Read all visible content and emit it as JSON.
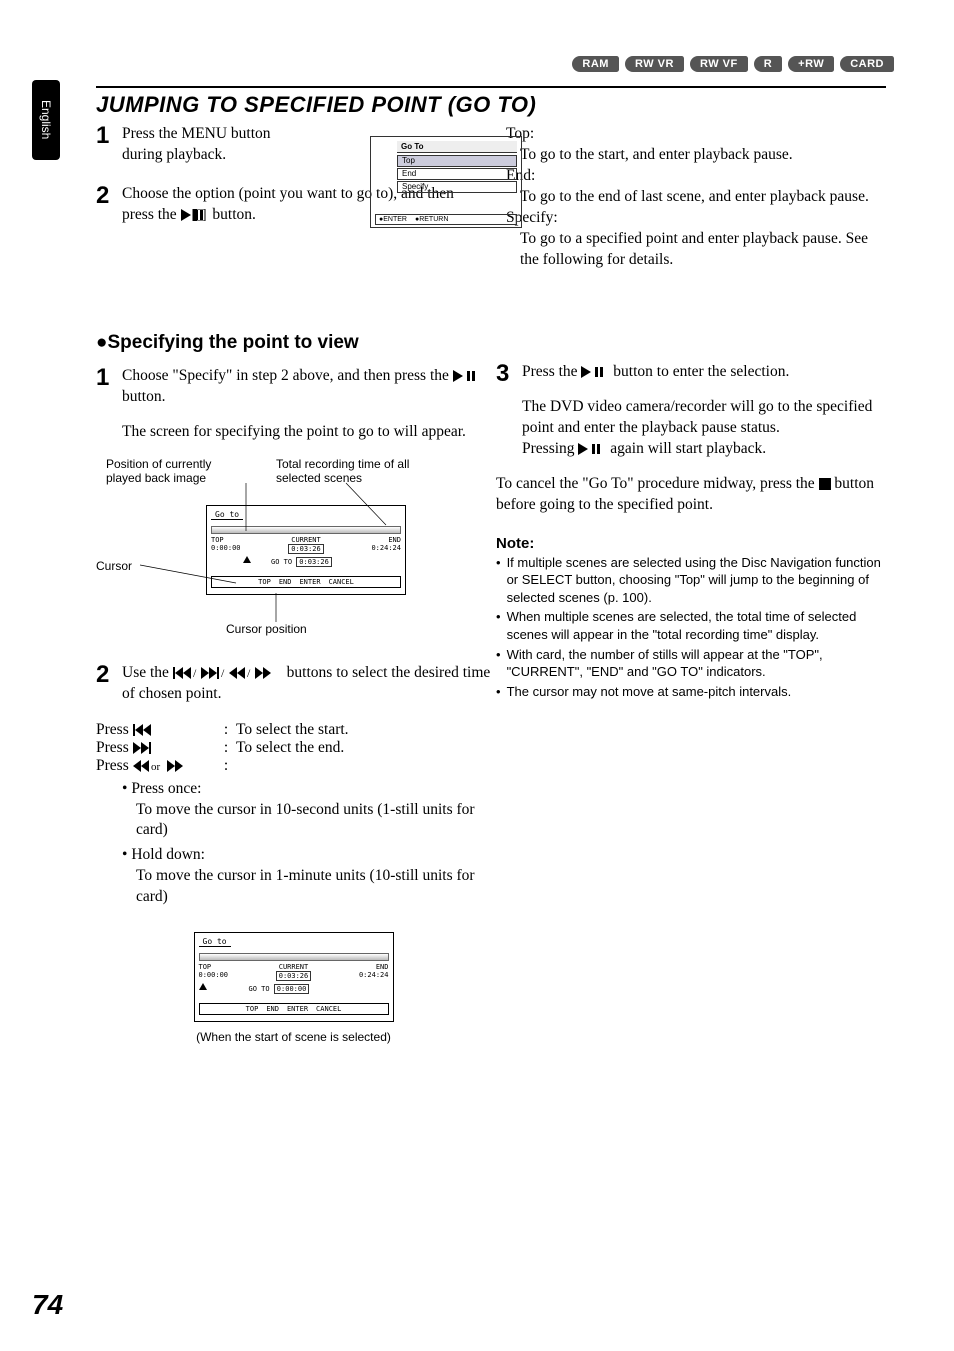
{
  "side_tab": "English",
  "badges": [
    "RAM",
    "RW VR",
    "RW VF",
    "R",
    "+RW",
    "CARD"
  ],
  "heading": "JUMPING TO SPECIFIED POINT (GO TO)",
  "step1a": "Press the MENU button during playback.",
  "step2a_line1": "Choose the option (point you want to go to), and then press the ",
  "step2a_line2": " button.",
  "osd1": {
    "title": "Go To",
    "items": [
      "Top",
      "End",
      "Specify"
    ],
    "bottom": [
      "ENTER",
      "RETURN"
    ]
  },
  "right_top": {
    "top_label": "Top:",
    "top_desc": "To go to the start, and enter playback pause.",
    "end_label": "End:",
    "end_desc": "To go to the end of last scene, and enter playback pause.",
    "spec_label": "Specify:",
    "spec_desc": "To go to a specified point and enter playback pause. See the following for details."
  },
  "subheading": "●Specifying the point to view",
  "step1b_line1": "Choose \"Specify\" in step 2 above, and then press the ",
  "step1b_line2": " button.",
  "step1b_para": "The screen for specifying the point to go to will appear.",
  "fig1": {
    "pos_label": "Position of currently played back image",
    "total_label": "Total recording time of all selected scenes",
    "cursor_label": "Cursor",
    "cursor_pos_label": "Cursor position",
    "title": "Go to",
    "top": "TOP",
    "top_time": "0:00:00",
    "current": "CURRENT",
    "current_time": "0:03:26",
    "end": "END",
    "end_time": "0:24:24",
    "goto_time": "0:03:26",
    "goto_label": "GO TO",
    "bottom": [
      "TOP",
      "END",
      "ENTER",
      "CANCEL"
    ]
  },
  "step2b_line1": "Use the ",
  "step2b_line2": " buttons to select the desired time of chosen point.",
  "press_rows": {
    "r1_left": "Press ",
    "r1_right": "To select the start.",
    "r2_left": "Press ",
    "r2_right": "To select the end.",
    "r3_left": "Press ",
    "r3_right": ""
  },
  "press_once_hd": "Press once:",
  "press_once_body": "To move the cursor in 10-second units (1-still units for card)",
  "hold_down_hd": "Hold down:",
  "hold_down_body": "To move the cursor in 1-minute units (10-still units for card)",
  "fig2": {
    "title": "Go to",
    "top": "TOP",
    "top_time": "0:00:00",
    "current": "CURRENT",
    "current_time": "0:03:26",
    "end": "END",
    "end_time": "0:24:24",
    "goto_label": "GO TO",
    "goto_time": "0:00:00",
    "bottom": [
      "TOP",
      "END",
      "ENTER",
      "CANCEL"
    ],
    "caption": "(When the start of scene is selected)"
  },
  "step3_line1": "Press the ",
  "step3_line2": " button to enter the selection.",
  "step3_para_line1": "The DVD video camera/recorder will go to the specified point and enter the playback pause status.",
  "step3_para_line2a": "Pressing ",
  "step3_para_line2b": " again will start playback.",
  "cancel_line1": "To cancel the \"Go To\" procedure midway, press the ",
  "cancel_line2": " button before going to the specified point.",
  "note_heading": "Note:",
  "notes": [
    "If multiple scenes are selected using the Disc Navigation function or SELECT button, choosing \"Top\" will jump to the beginning of selected scenes (p. 100).",
    "When multiple scenes are selected, the total time of selected scenes will appear in the \"total recording time\" display.",
    "With card, the number of stills will appear at the \"TOP\", \"CURRENT\", \"END\" and \"GO TO\" indicators.",
    "The cursor may not move at same-pitch intervals."
  ],
  "pagenum": "74"
}
